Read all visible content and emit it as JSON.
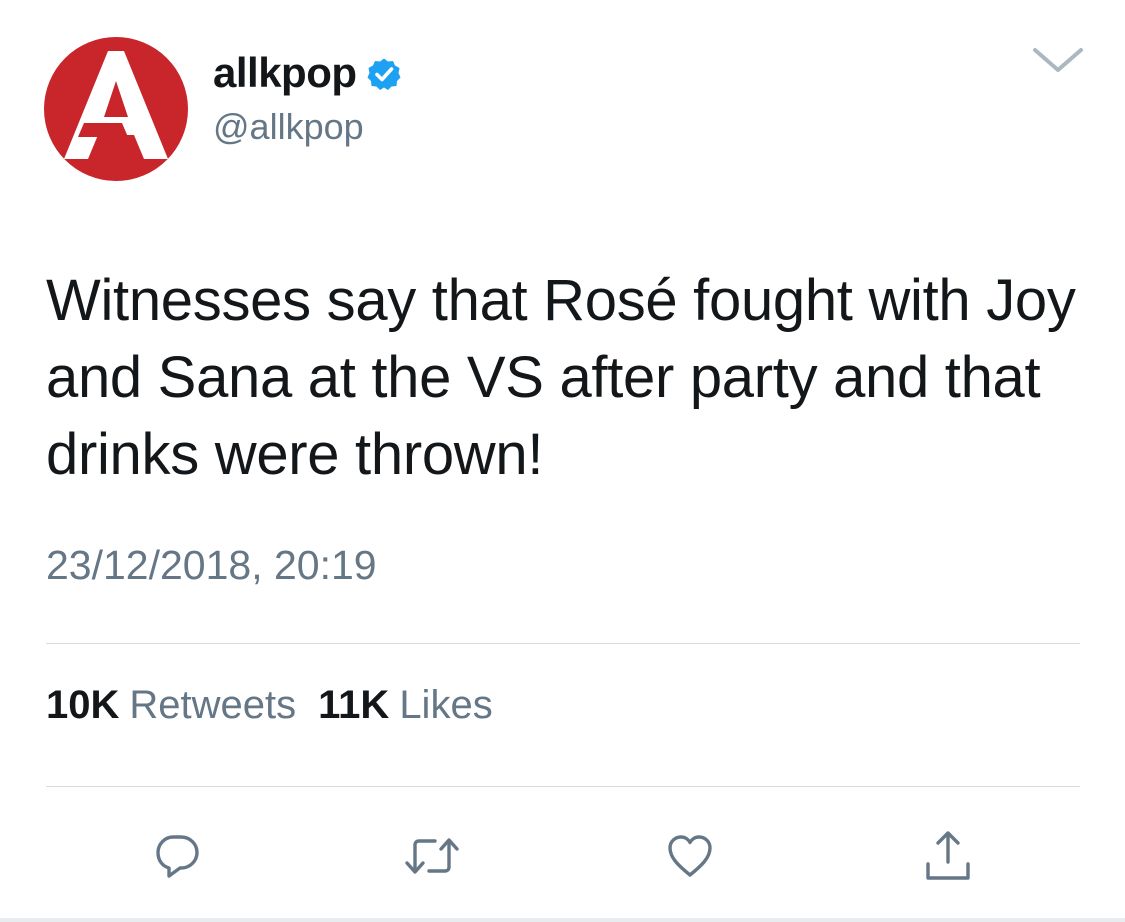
{
  "tweet": {
    "display_name": "allkpop",
    "handle": "@allkpop",
    "verified": true,
    "text": "Witnesses say that Rosé fought with Joy and Sana at the VS after party and that drinks were thrown!",
    "timestamp": "23/12/2018, 20:19"
  },
  "stats": {
    "retweets_count": "10K",
    "retweets_label": "Retweets",
    "likes_count": "11K",
    "likes_label": "Likes"
  },
  "icons": {
    "avatar": "allkpop-logo",
    "verified": "verified-badge-icon",
    "menu": "chevron-down-icon",
    "reply": "reply-icon",
    "retweet": "retweet-icon",
    "like": "heart-icon",
    "share": "share-icon"
  },
  "colors": {
    "brand_red": "#c8262b",
    "verified_blue": "#1da1f2",
    "text_primary": "#14171a",
    "text_secondary": "#657786",
    "icon_gray": "#657786",
    "divider": "#d4dadf"
  }
}
